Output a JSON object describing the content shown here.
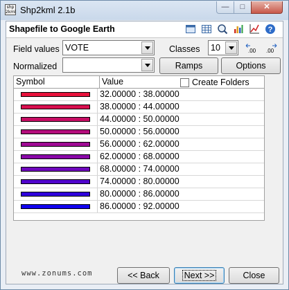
{
  "window": {
    "title": "Shp2kml 2.1b",
    "app_icon_text": "Shp\n2kml",
    "min_symbol": "—",
    "max_symbol": "□",
    "close_symbol": "✕"
  },
  "header": {
    "title": "Shapefile to Google Earth"
  },
  "form": {
    "field_values_label": "Field values",
    "field_values_value": "VOTE",
    "classes_label": "Classes",
    "classes_value": "10",
    "normalized_label": "Normalized",
    "normalized_value": "",
    "ramps_label": "Ramps",
    "options_label": "Options",
    "create_folders_label": "Create Folders",
    "create_folders_checked": false
  },
  "table": {
    "columns": [
      "Symbol",
      "Value"
    ],
    "rows": [
      {
        "color": "#e8123c",
        "value": "32.00000 : 38.00000"
      },
      {
        "color": "#d81050",
        "value": "38.00000 : 44.00000"
      },
      {
        "color": "#c80e64",
        "value": "44.00000 : 50.00000"
      },
      {
        "color": "#b40c7c",
        "value": "50.00000 : 56.00000"
      },
      {
        "color": "#a00a94",
        "value": "56.00000 : 62.00000"
      },
      {
        "color": "#8a08a8",
        "value": "62.00000 : 68.00000"
      },
      {
        "color": "#6e06bc",
        "value": "68.00000 : 74.00000"
      },
      {
        "color": "#5004cc",
        "value": "74.00000 : 80.00000"
      },
      {
        "color": "#3002dc",
        "value": "80.00000 : 86.00000"
      },
      {
        "color": "#1000ee",
        "value": "86.00000 : 92.00000"
      }
    ]
  },
  "footer": {
    "website": "www.zonums.com",
    "back_label": "<< Back",
    "next_label": "Next >>",
    "close_label": "Close"
  }
}
